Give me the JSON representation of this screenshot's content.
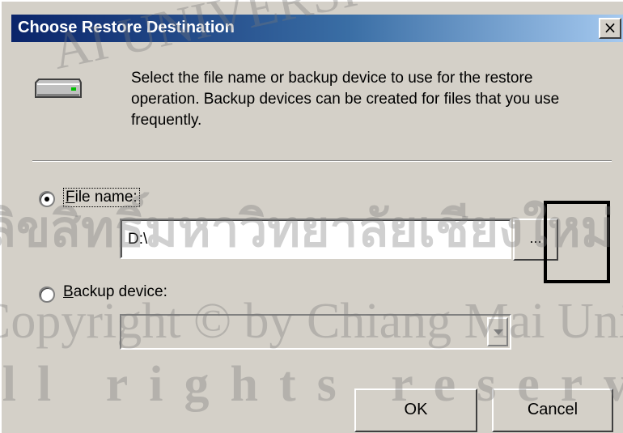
{
  "window": {
    "title": "Choose Restore Destination",
    "close_glyph": "×"
  },
  "intro_text": "Select the file name or backup device to use for the restore operation.  Backup devices can be created for files that you use frequently.",
  "options": {
    "file_name": {
      "label_underlined": "F",
      "label_rest": "ile name:",
      "selected": true,
      "value": "D:\\",
      "browse_label": "..."
    },
    "backup_device": {
      "label_underlined": "B",
      "label_rest": "ackup device:",
      "selected": false,
      "value": ""
    }
  },
  "buttons": {
    "ok": "OK",
    "cancel": "Cancel"
  },
  "watermark": {
    "line1": "AI UNIVERSI",
    "line2": "ลิขสิทธิ์มหาวิทยาลัยเชียงใหม่",
    "line3": "Copyright © by Chiang Mai University",
    "line4": "All rights reserved"
  },
  "colors": {
    "dialog_bg": "#d4d0c8",
    "title_bar_start": "#0a246a",
    "title_bar_end": "#a6caf0",
    "highlight_box": "#000000"
  },
  "icons": {
    "drive": "drive-icon",
    "close": "close-icon",
    "dropdown": "chevron-down-icon"
  }
}
